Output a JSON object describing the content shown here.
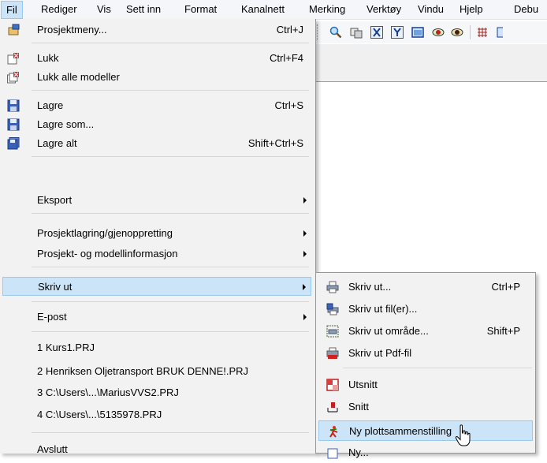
{
  "menubar": {
    "items": [
      {
        "label": "Fil"
      },
      {
        "label": "Rediger"
      },
      {
        "label": "Vis"
      },
      {
        "label": "Sett inn"
      },
      {
        "label": "Format"
      },
      {
        "label": "Kanalnett"
      },
      {
        "label": "Merking"
      },
      {
        "label": "Verktøy"
      },
      {
        "label": "Vindu"
      },
      {
        "label": "Hjelp"
      },
      {
        "label": "Debu"
      }
    ]
  },
  "file_menu": {
    "items": [
      {
        "label": "Prosjektmeny...",
        "shortcut": "Ctrl+J"
      },
      {
        "label": "Lukk",
        "shortcut": "Ctrl+F4"
      },
      {
        "label": "Lukk alle modeller",
        "shortcut": ""
      },
      {
        "label": "Lagre",
        "shortcut": "Ctrl+S"
      },
      {
        "label": "Lagre som...",
        "shortcut": ""
      },
      {
        "label": "Lagre alt",
        "shortcut": "Shift+Ctrl+S"
      },
      {
        "label": "Eksport"
      },
      {
        "label": "Prosjektlagring/gjenoppretting"
      },
      {
        "label": "Prosjekt- og modellinformasjon"
      },
      {
        "label": "Skriv ut"
      },
      {
        "label": "E-post"
      },
      {
        "label": "1 Kurs1.PRJ"
      },
      {
        "label": "2 Henriksen Oljetransport BRUK DENNE!.PRJ"
      },
      {
        "label": "3 C:\\Users\\...\\MariusVVS2.PRJ"
      },
      {
        "label": "4 C:\\Users\\...\\5135978.PRJ"
      },
      {
        "label": "Avslutt"
      }
    ]
  },
  "print_submenu": {
    "items": [
      {
        "label": "Skriv ut...",
        "shortcut": "Ctrl+P"
      },
      {
        "label": "Skriv ut fil(er)...",
        "shortcut": ""
      },
      {
        "label": "Skriv ut område...",
        "shortcut": "Shift+P"
      },
      {
        "label": "Skriv ut Pdf-fil",
        "shortcut": ""
      },
      {
        "label": "Utsnitt",
        "shortcut": ""
      },
      {
        "label": "Snitt",
        "shortcut": ""
      },
      {
        "label": "Ny plottsammenstilling",
        "shortcut": ""
      },
      {
        "label": "Ny...",
        "shortcut": ""
      }
    ]
  },
  "colors": {
    "highlight": "#cce4f7",
    "highlight_border": "#99c9ef",
    "menu_bg": "#f2f2f2"
  }
}
